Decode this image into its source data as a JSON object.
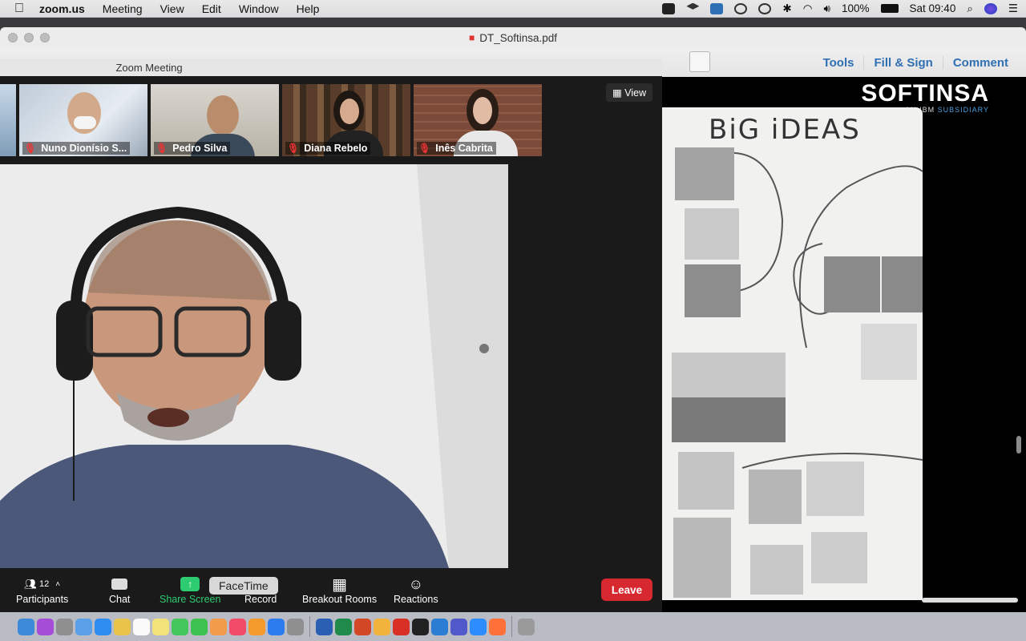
{
  "menubar": {
    "app_name": "zoom.us",
    "items": [
      "Meeting",
      "View",
      "Edit",
      "Window",
      "Help"
    ],
    "battery": "100%",
    "clock": "Sat 09:40"
  },
  "pdf": {
    "filename": "DT_Softinsa.pdf",
    "actions": [
      "Tools",
      "Fill & Sign",
      "Comment"
    ],
    "brand": "SOFTINSA",
    "brand_sub_prefix": "AN IBM",
    "brand_sub_highlight": "SUBSIDIARY",
    "whiteboard_title": "BiG iDEAS"
  },
  "zoom": {
    "window_title": "Zoom Meeting",
    "view_label": "View",
    "participants": [
      {
        "name": "Nuno Dionísio S..."
      },
      {
        "name": "Pedro Silva"
      },
      {
        "name": "Diana Rebelo"
      },
      {
        "name": "Inês Cabrita"
      }
    ],
    "controls": {
      "participants_label": "Participants",
      "participants_count": "12",
      "chat_label": "Chat",
      "share_label": "Share Screen",
      "record_label": "Record",
      "breakout_label": "Breakout Rooms",
      "reactions_label": "Reactions",
      "leave_label": "Leave"
    },
    "tooltip": "FaceTime"
  },
  "dock": {
    "icons": [
      "finder-icon",
      "siri-icon",
      "launchpad-icon",
      "mail-icon",
      "safari-icon",
      "notes-icon",
      "calendar-icon",
      "stickies-icon",
      "messages-icon",
      "facetime-icon",
      "photos-icon",
      "music-icon",
      "books-icon",
      "appstore-icon",
      "settings-icon",
      "word-icon",
      "excel-icon",
      "powerpoint-icon",
      "chrome-icon",
      "acrobat-icon",
      "terminal-icon",
      "vscode-icon",
      "teams-icon",
      "zoom-icon",
      "firefox-icon",
      "trash-icon"
    ]
  }
}
